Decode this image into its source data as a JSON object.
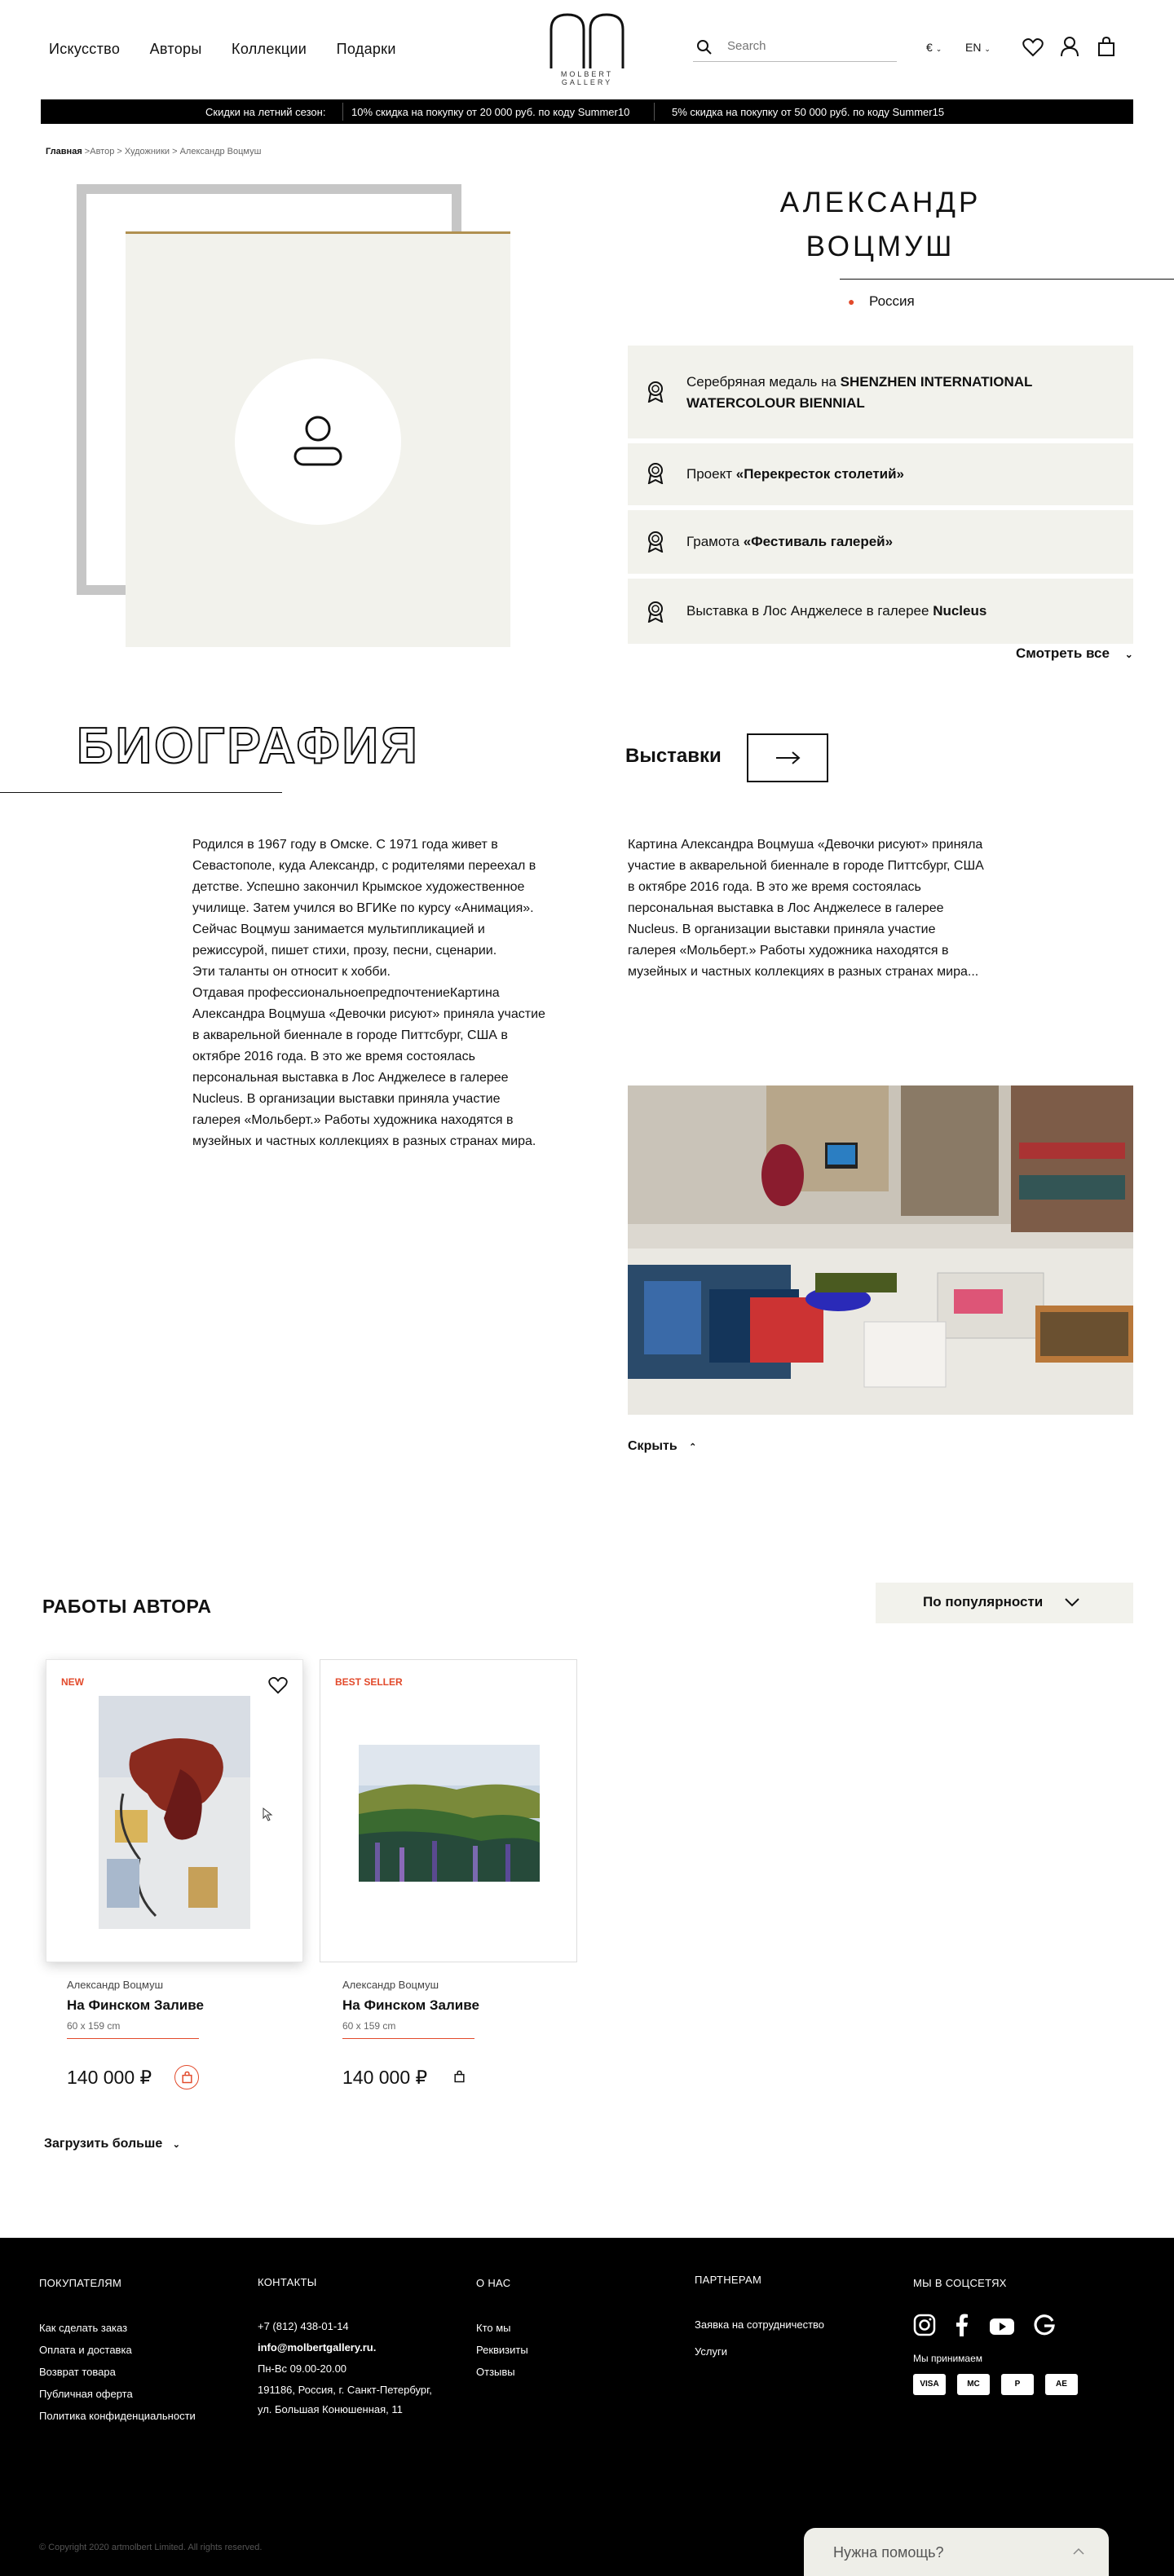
{
  "header": {
    "nav": [
      "Искусство",
      "Авторы",
      "Коллекции",
      "Подарки"
    ],
    "logo_text": "MOLBERT GALLERY",
    "search_placeholder": "Search",
    "currency": "€",
    "language": "EN"
  },
  "promo": {
    "label": "Скидки на летний сезон:",
    "offer1": "10% скидка на покупку от 20 000 руб. по коду Summer10",
    "offer2": "5% скидка на покупку от 50 000 руб. по коду Summer15"
  },
  "breadcrumbs": {
    "home": "Главная",
    "rest": " >Автор > Художники > Александр Воцмуш"
  },
  "artist": {
    "name_line1": "АЛЕКСАНДР",
    "name_line2": "ВОЦМУШ",
    "country": "Россия"
  },
  "awards": [
    {
      "prefix": "Серебряная медаль на ",
      "bold": "SHENZHEN INTERNATIONAL WATERCOLOUR BIENNIAL"
    },
    {
      "prefix": "Проект ",
      "bold": "«Перекресток столетий»"
    },
    {
      "prefix": "Грамота ",
      "bold": "«Фестиваль галерей»"
    },
    {
      "prefix": "Выставка в Лос Анджелесе в галерее ",
      "bold": "Nucleus"
    }
  ],
  "see_all": "Смотреть все",
  "biography": {
    "title": "БИОГРАФИЯ",
    "text": "Родился в 1967 году в Омске. С 1971 года живет в Севастополе, куда Александр, с родителями переехал в детстве. Успешно закончил Крымское художественное училище. Затем учился во ВГИКе по курсу «Анимация». Сейчас Воцмуш занимается мультипликацией и режиссурой, пишет стихи, прозу, песни, сценарии.\nЭти таланты он относит к хобби.\nОтдавая профессиональноепредпочтениеКартина Александра Воцмуша «Девочки рисуют» приняла участие в акварельной биеннале в городе Питтсбург, США в октябре 2016 года.  В это же время состоялась персональная выставка в Лос Анджелесе в галерее Nucleus. В организации выставки приняла участие галерея «Мольберт.» Работы художника находятся в музейных и частных коллекциях в разных странах мира."
  },
  "exhibitions": {
    "title": "Выставки",
    "text": "Картина Александра Воцмуша «Девочки рисуют» приняла участие в акварельной биеннале в городе Питтсбург, США в октябре 2016 года.  В это же время состоялась персональная выставка в Лос Анджелесе в галерее Nucleus. В организации выставки приняла участие галерея «Мольберт.» Работы художника находятся в музейных и частных коллекциях в разных странах мира...",
    "hide": "Скрыть"
  },
  "works": {
    "title": "РАБОТЫ АВТОРА",
    "sort": "По популярности",
    "load_more": "Загрузить больше",
    "items": [
      {
        "badge": "NEW",
        "author": "Александр Воцмуш",
        "title": "На Финском Заливе",
        "size": "60 x 159 cm",
        "price": "140 000 ₽"
      },
      {
        "badge": "BEST SELLER",
        "author": "Александр Воцмуш",
        "title": "На Финском Заливе",
        "size": "60 x 159 cm",
        "price": "140 000 ₽"
      }
    ]
  },
  "footer": {
    "buyers": {
      "title": "ПОКУПАТЕЛЯМ",
      "items": [
        "Как сделать заказ",
        "Оплата и доставка",
        "Возврат товара",
        "Публичная оферта",
        "Политика конфиденциальности"
      ]
    },
    "contacts": {
      "title": "КОНТАКТЫ",
      "phone": "+7 (812) 438-01-14",
      "email": "info@molbertgallery.ru.",
      "hours": "Пн-Вс  09.00-20.00",
      "address1": "191186, Россия, г. Санкт-Петербург,",
      "address2": "ул. Большая Конюшенная, 11"
    },
    "about": {
      "title": "О НАС",
      "items": [
        "Кто мы",
        "Реквизиты",
        "Отзывы"
      ]
    },
    "partners": {
      "title": "ПАРТНЕРАМ",
      "items": [
        "Заявка на сотрудничество",
        "Услуги"
      ]
    },
    "social": {
      "title": "МЫ В СОЦСЕТЯХ",
      "accept": "Мы принимаем",
      "payments": [
        "VISA",
        "MC",
        "P",
        "AE"
      ]
    },
    "copyright": "© Copyright 2020 artmolbert Limited. All rights reserved.",
    "help": "Нужна помощь?"
  }
}
